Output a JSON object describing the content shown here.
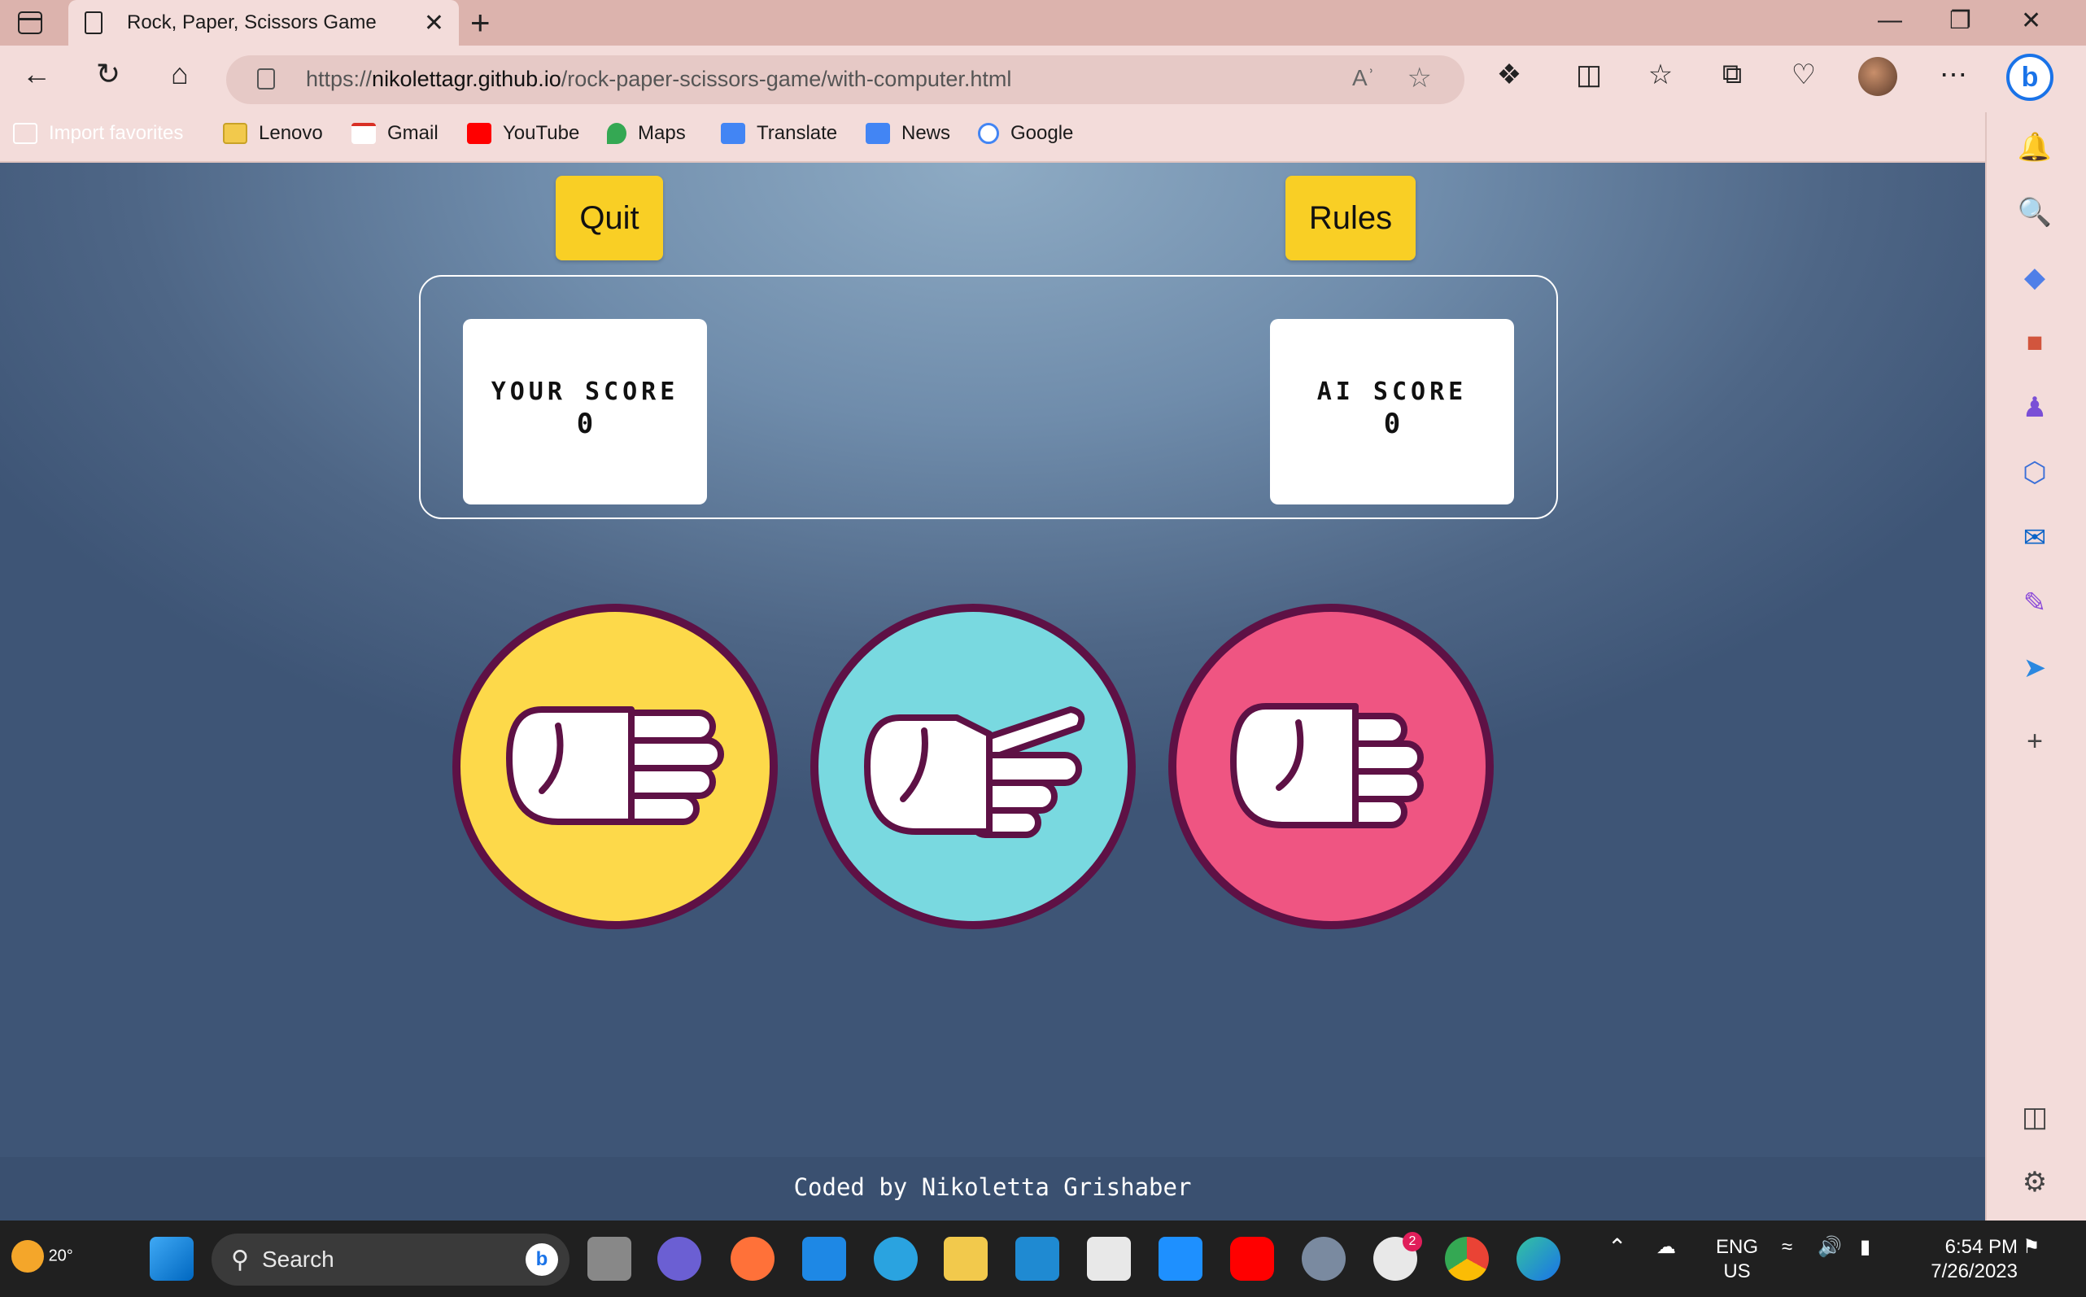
{
  "browser": {
    "tab_title": "Rock, Paper, Scissors Game",
    "url_prefix": "https://",
    "url_domain": "nikolettagr.github.io",
    "url_path": "/rock-paper-scissors-game/with-computer.html",
    "new_tab": "+",
    "close_tab": "✕",
    "minimize": "—",
    "restore": "❐",
    "close_window": "✕",
    "read_aloud": "Aʾ",
    "favorite": "☆"
  },
  "favorites": [
    {
      "label": "Import favorites",
      "icon": "import-icon",
      "color": "#ffffff"
    },
    {
      "label": "Lenovo",
      "icon": "folder-icon",
      "color": "#f2c94c"
    },
    {
      "label": "Gmail",
      "icon": "gmail-icon",
      "color": "#d93025"
    },
    {
      "label": "YouTube",
      "icon": "youtube-icon",
      "color": "#ff0000"
    },
    {
      "label": "Maps",
      "icon": "maps-icon",
      "color": "#34a853"
    },
    {
      "label": "Translate",
      "icon": "translate-icon",
      "color": "#4285f4"
    },
    {
      "label": "News",
      "icon": "news-icon",
      "color": "#4285f4"
    },
    {
      "label": "Google",
      "icon": "google-icon",
      "color": "#4285f4"
    }
  ],
  "game": {
    "quit_label": "Quit",
    "rules_label": "Rules",
    "your_score_label": "YOUR SCORE",
    "your_score": "0",
    "ai_score_label": "AI SCORE",
    "ai_score": "0",
    "choices": [
      {
        "name": "paper",
        "color": "#fdd94a"
      },
      {
        "name": "scissors",
        "color": "#79d9e0"
      },
      {
        "name": "rock",
        "color": "#ef5582"
      }
    ],
    "footer": "Coded by Nikoletta Grishaber"
  },
  "colors": {
    "button_yellow": "#f9cf25",
    "choice_border": "#5e1145"
  },
  "taskbar": {
    "weather_temp": "20°",
    "search_placeholder": "Search",
    "slack_badge": "2",
    "lang_line1": "ENG",
    "lang_line2": "US",
    "time": "6:54 PM",
    "date": "7/26/2023"
  }
}
